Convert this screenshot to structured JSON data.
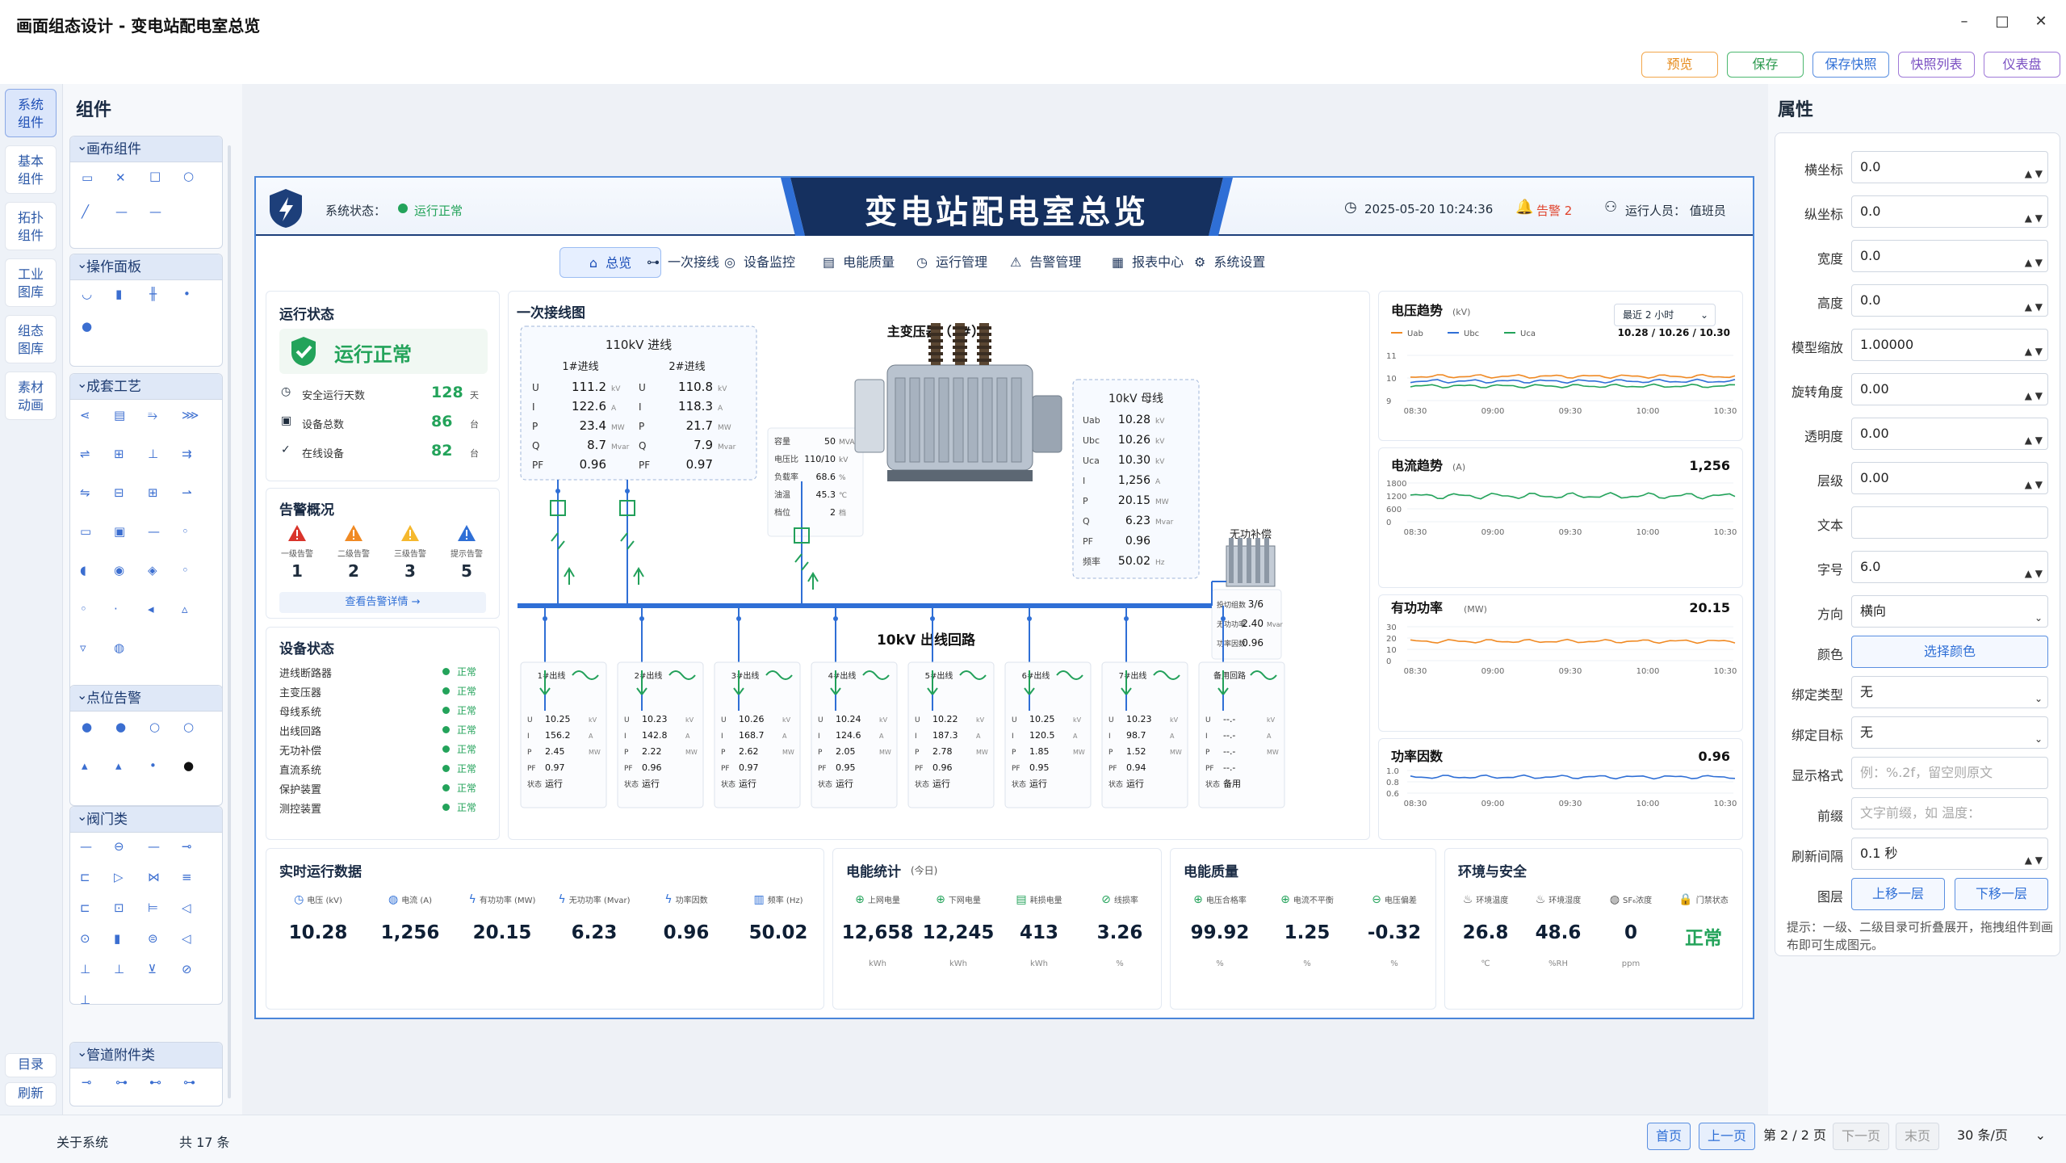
{
  "window": {
    "title": "画面组态设计 - 变电站配电室总览",
    "min": "–",
    "max": "□",
    "close": "✕"
  },
  "toolbar": {
    "preview": "预览",
    "save": "保存",
    "save_snapshot": "保存快照",
    "snapshot_list": "快照列表",
    "dashboard": "仪表盘"
  },
  "left_nav": [
    "系统\n组件",
    "基本\n组件",
    "拓扑\n组件",
    "工业\n图库",
    "组态\n图库",
    "素材\n动画"
  ],
  "left_nav_bottom": {
    "dir": "目录",
    "refresh": "刷新"
  },
  "components": {
    "title": "组件",
    "groups": [
      "画布组件",
      "操作面板",
      "成套工艺",
      "点位告警",
      "阀门类",
      "管道附件类"
    ]
  },
  "props": {
    "title": "属性",
    "fields": [
      {
        "label": "横坐标",
        "value": "0.0"
      },
      {
        "label": "纵坐标",
        "value": "0.0"
      },
      {
        "label": "宽度",
        "value": "0.0"
      },
      {
        "label": "高度",
        "value": "0.0"
      },
      {
        "label": "模型缩放",
        "value": "1.00000"
      },
      {
        "label": "旋转角度",
        "value": "0.00"
      },
      {
        "label": "透明度",
        "value": "0.00"
      },
      {
        "label": "层级",
        "value": "0.00"
      },
      {
        "label": "文本",
        "value": ""
      },
      {
        "label": "字号",
        "value": "6.0"
      }
    ],
    "direction_label": "方向",
    "direction": "横向",
    "color_label": "颜色",
    "color_btn": "选择颜色",
    "bind_type_label": "绑定类型",
    "bind_type": "无",
    "bind_target_label": "绑定目标",
    "bind_target": "无",
    "format_label": "显示格式",
    "format_ph": "例：%.2f，留空则原文",
    "prefix_label": "前缀",
    "prefix_ph": "文字前缀，如 温度：",
    "refresh_label": "刷新间隔",
    "refresh": "0.1 秒",
    "layer_label": "图层",
    "layer_up": "上移一层",
    "layer_down": "下移一层",
    "hint": "提示：一级、二级目录可折叠展开，拖拽组件到画布即可生成图元。"
  },
  "footer": {
    "about": "关于系统",
    "count": "共 17 条",
    "first": "首页",
    "prev": "上一页",
    "page": "第 2 / 2 页",
    "next": "下一页",
    "last": "末页",
    "per": "30 条/页"
  },
  "dash": {
    "title": "变电站配电室总览",
    "status_label": "系统状态：",
    "status": "运行正常",
    "datetime": "2025-05-20  10:24:36",
    "alarm": "告警 2",
    "operator": "运行人员： 值班员",
    "tabs": [
      "总览",
      "一次接线",
      "设备监控",
      "电能质量",
      "运行管理",
      "告警管理",
      "报表中心",
      "系统设置"
    ],
    "run": {
      "title": "运行状态",
      "state": "运行正常",
      "rows": [
        {
          "k": "安全运行天数",
          "v": "128",
          "u": "天"
        },
        {
          "k": "设备总数",
          "v": "86",
          "u": "台"
        },
        {
          "k": "在线设备",
          "v": "82",
          "u": "台"
        }
      ]
    },
    "alarm_box": {
      "title": "告警概况",
      "items": [
        {
          "k": "一级告警",
          "v": "1",
          "c": "#d9342b"
        },
        {
          "k": "二级告警",
          "v": "2",
          "c": "#f08a24"
        },
        {
          "k": "三级告警",
          "v": "3",
          "c": "#f5b82e"
        },
        {
          "k": "提示告警",
          "v": "5",
          "c": "#2f6fd6"
        }
      ],
      "link": "查看告警详情  →"
    },
    "dev": {
      "title": "设备状态",
      "rows": [
        "进线断路器",
        "主变压器",
        "母线系统",
        "出线回路",
        "无功补偿",
        "直流系统",
        "保护装置",
        "测控装置"
      ],
      "state": "正常"
    },
    "wiring": {
      "title": "一次接线图",
      "in_title": "110kV 进线",
      "in1": {
        "name": "1#进线",
        "U": "111.2",
        "I": "122.6",
        "P": "23.4",
        "Q": "8.7",
        "PF": "0.96"
      },
      "in2": {
        "name": "2#进线",
        "U": "110.8",
        "I": "118.3",
        "P": "21.7",
        "Q": "7.9",
        "PF": "0.97"
      },
      "units": {
        "U": "kV",
        "I": "A",
        "P": "MW",
        "Q": "Mvar"
      },
      "tr_title": "主变压器（1#）",
      "tr": [
        {
          "k": "容量",
          "v": "50",
          "u": "MVA"
        },
        {
          "k": "电压比",
          "v": "110/10",
          "u": "kV"
        },
        {
          "k": "负载率",
          "v": "68.6",
          "u": "%"
        },
        {
          "k": "油温",
          "v": "45.3",
          "u": "℃"
        },
        {
          "k": "档位",
          "v": "2",
          "u": "档"
        }
      ],
      "bus_title": "10kV 母线",
      "bus": [
        {
          "k": "Uab",
          "v": "10.28",
          "u": "kV"
        },
        {
          "k": "Ubc",
          "v": "10.26",
          "u": "kV"
        },
        {
          "k": "Uca",
          "v": "10.30",
          "u": "kV"
        },
        {
          "k": "I",
          "v": "1,256",
          "u": "A"
        },
        {
          "k": "P",
          "v": "20.15",
          "u": "MW"
        },
        {
          "k": "Q",
          "v": "6.23",
          "u": "Mvar"
        },
        {
          "k": "PF",
          "v": "0.96",
          "u": ""
        },
        {
          "k": "频率",
          "v": "50.02",
          "u": "Hz"
        }
      ],
      "comp_title": "无功补偿",
      "comp": [
        {
          "k": "投切组数",
          "v": "3/6",
          "u": ""
        },
        {
          "k": "无功功率",
          "v": "2.40",
          "u": "Mvar"
        },
        {
          "k": "功率因数",
          "v": "0.96",
          "u": ""
        }
      ],
      "out_title": "10kV 出线回路",
      "outs": [
        {
          "n": "1#出线",
          "U": "10.25",
          "I": "156.2",
          "P": "2.45",
          "PF": "0.97",
          "S": "运行"
        },
        {
          "n": "2#出线",
          "U": "10.23",
          "I": "142.8",
          "P": "2.22",
          "PF": "0.96",
          "S": "运行"
        },
        {
          "n": "3#出线",
          "U": "10.26",
          "I": "168.7",
          "P": "2.62",
          "PF": "0.97",
          "S": "运行"
        },
        {
          "n": "4#出线",
          "U": "10.24",
          "I": "124.6",
          "P": "2.05",
          "PF": "0.95",
          "S": "运行"
        },
        {
          "n": "5#出线",
          "U": "10.22",
          "I": "187.3",
          "P": "2.78",
          "PF": "0.96",
          "S": "运行"
        },
        {
          "n": "6#出线",
          "U": "10.25",
          "I": "120.5",
          "P": "1.85",
          "PF": "0.95",
          "S": "运行"
        },
        {
          "n": "7#出线",
          "U": "10.23",
          "I": "98.7",
          "P": "1.52",
          "PF": "0.94",
          "S": "运行"
        }
      ],
      "spare": {
        "n": "备用回路",
        "U": "--.-",
        "I": "--.-",
        "P": "--.-",
        "PF": "--.-",
        "S": "备用"
      },
      "row_labels": {
        "U": "U",
        "I": "I",
        "P": "P",
        "PF": "PF",
        "S": "状态"
      }
    },
    "charts": {
      "xticks": [
        "08:30",
        "09:00",
        "09:30",
        "10:00",
        "10:30"
      ],
      "voltage": {
        "title": "电压趋势",
        "unit": "(kV)",
        "range": "最近 2 小时",
        "legend": [
          "Uab",
          "Ubc",
          "Uca"
        ],
        "value": "10.28  /  10.26  /  10.30",
        "yt": [
          "11",
          "10",
          "9"
        ]
      },
      "current": {
        "title": "电流趋势",
        "unit": "(A)",
        "value": "1,256",
        "yt": [
          "1800",
          "1200",
          "600",
          "0"
        ]
      },
      "power": {
        "title": "有功功率",
        "unit": "(MW)",
        "value": "20.15",
        "yt": [
          "30",
          "20",
          "10",
          "0"
        ]
      },
      "pf": {
        "title": "功率因数",
        "value": "0.96",
        "yt": [
          "1.0",
          "0.8",
          "0.6"
        ]
      }
    },
    "rt": {
      "title": "实时运行数据",
      "items": [
        {
          "k": "电压 (kV)",
          "v": "10.28"
        },
        {
          "k": "电流 (A)",
          "v": "1,256"
        },
        {
          "k": "有功功率 (MW)",
          "v": "20.15"
        },
        {
          "k": "无功功率 (Mvar)",
          "v": "6.23"
        },
        {
          "k": "功率因数",
          "v": "0.96"
        },
        {
          "k": "频率 (Hz)",
          "v": "50.02"
        }
      ]
    },
    "energy": {
      "title": "电能统计",
      "sub": "(今日)",
      "items": [
        {
          "k": "上网电量",
          "v": "12,658",
          "u": "kWh"
        },
        {
          "k": "下网电量",
          "v": "12,245",
          "u": "kWh"
        },
        {
          "k": "耗损电量",
          "v": "413",
          "u": "kWh"
        },
        {
          "k": "线损率",
          "v": "3.26",
          "u": "%"
        }
      ]
    },
    "quality": {
      "title": "电能质量",
      "items": [
        {
          "k": "电压合格率",
          "v": "99.92",
          "u": "%"
        },
        {
          "k": "电流不平衡",
          "v": "1.25",
          "u": "%"
        },
        {
          "k": "电压偏差",
          "v": "-0.32",
          "u": "%"
        }
      ]
    },
    "env": {
      "title": "环境与安全",
      "items": [
        {
          "k": "环境温度",
          "v": "26.8",
          "u": "℃"
        },
        {
          "k": "环境湿度",
          "v": "48.6",
          "u": "%RH"
        },
        {
          "k": "SF₆浓度",
          "v": "0",
          "u": "ppm"
        },
        {
          "k": "门禁状态",
          "v": "正常",
          "u": ""
        }
      ]
    }
  }
}
